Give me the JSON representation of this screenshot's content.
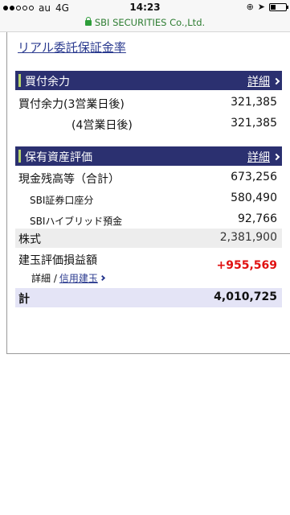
{
  "status": {
    "carrier": "au",
    "network": "4G",
    "time": "14:23",
    "url": "SBI SECURITIES Co.,Ltd.",
    "battery_level": 0.35
  },
  "margin_link": "リアル委託保証金率",
  "buying_power": {
    "title": "買付余力",
    "detail": "詳細",
    "rows": [
      {
        "label": "買付余力(3営業日後)",
        "value": "321,385"
      },
      {
        "label": "(4営業日後)",
        "value": "321,385"
      }
    ]
  },
  "assets": {
    "title": "保有資産評価",
    "detail": "詳細",
    "cash_label": "現金残高等（合計）",
    "cash_value": "673,256",
    "sbi_account_label": "SBI証券口座分",
    "sbi_account_value": "580,490",
    "hybrid_label": "SBIハイブリッド預金",
    "hybrid_value": "92,766",
    "stocks_label": "株式",
    "stocks_value": "2,381,900",
    "pl_label": "建玉評価損益額",
    "pl_value": "+955,569",
    "pl_detail": "詳細 /",
    "pl_link": "信用建玉",
    "total_label": "計",
    "total_value": "4,010,725"
  }
}
